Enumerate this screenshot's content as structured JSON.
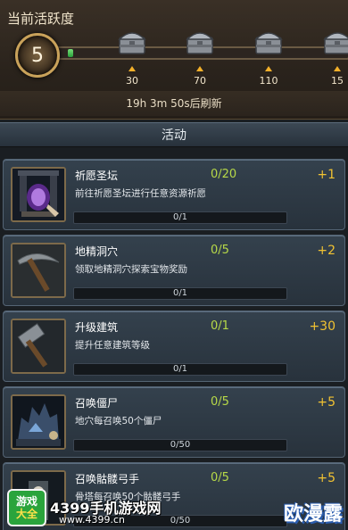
{
  "activity": {
    "title": "当前活跃度",
    "level": "5",
    "progress_fraction": 0.02,
    "milestones": [
      {
        "value": "30",
        "icon": "chest-icon"
      },
      {
        "value": "70",
        "icon": "chest-icon"
      },
      {
        "value": "110",
        "icon": "chest-icon"
      },
      {
        "value": "15",
        "icon": "chest-icon"
      }
    ],
    "refresh_text": "19h 3m 50s后刷新"
  },
  "section": {
    "title": "活动"
  },
  "tasks": [
    {
      "title": "祈愿圣坛",
      "count": "0/20",
      "reward": "+1",
      "desc": "前往祈愿圣坛进行任意资源祈愿",
      "progress": "0/1",
      "icon": "altar-icon"
    },
    {
      "title": "地精洞穴",
      "count": "0/5",
      "reward": "+2",
      "desc": "领取地精洞穴探索宝物奖励",
      "progress": "0/1",
      "icon": "pickaxe-icon"
    },
    {
      "title": "升级建筑",
      "count": "0/1",
      "reward": "+30",
      "desc": "提升任意建筑等级",
      "progress": "0/1",
      "icon": "hammer-icon"
    },
    {
      "title": "召唤僵尸",
      "count": "0/5",
      "reward": "+5",
      "desc": "地穴每召唤50个僵尸",
      "progress": "0/50",
      "icon": "crypt-icon"
    },
    {
      "title": "召唤骷髅弓手",
      "count": "0/5",
      "reward": "+5",
      "desc": "骨塔每召唤50个骷髅弓手",
      "progress": "0/50",
      "icon": "skeleton-tower-icon"
    }
  ],
  "watermark": {
    "badge_line1": "游戏",
    "badge_line2": "大全",
    "site_name": "4399手机游戏网",
    "site_url": "www.4399.cn",
    "right_text": "欧漫露"
  }
}
